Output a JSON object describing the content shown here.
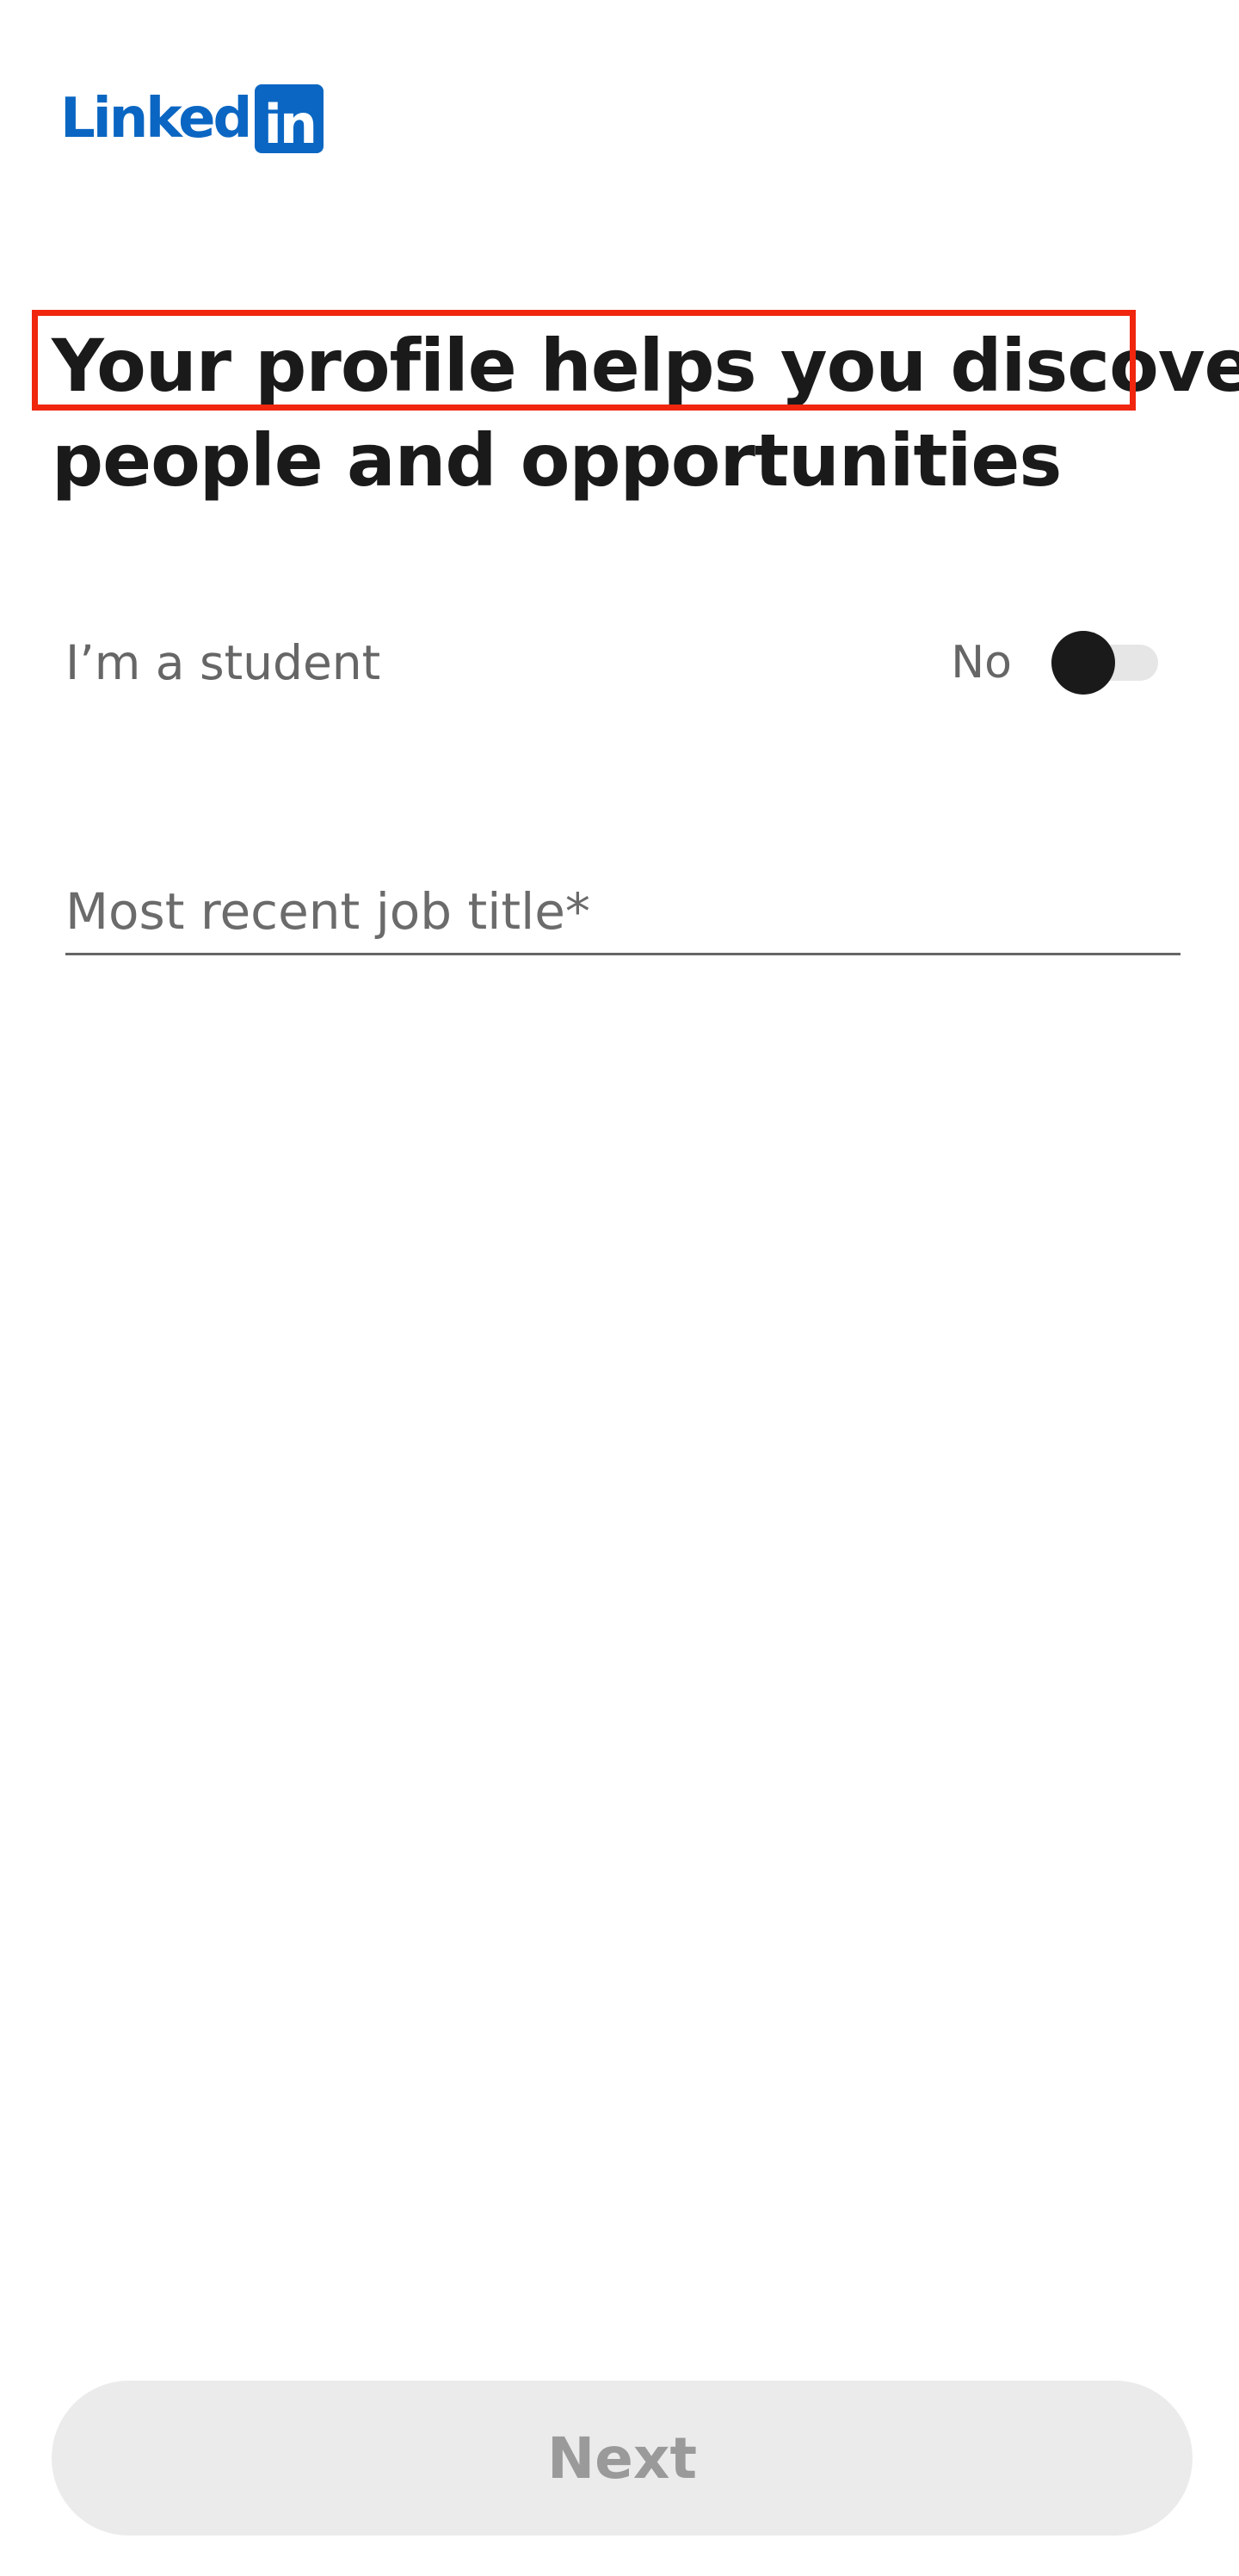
{
  "brand": {
    "word": "Linked",
    "box": "in",
    "color": "#0a66c2"
  },
  "headline": {
    "line1": "Your profile helps you discover",
    "line2": "people and opportunities"
  },
  "student": {
    "label": "I’m a student",
    "toggle_state": "No",
    "checked": false
  },
  "job_title": {
    "placeholder": "Most recent job title*",
    "value": ""
  },
  "next_button": {
    "label": "Next",
    "enabled": false
  },
  "colors": {
    "highlight_box": "#f0260e",
    "text_dark": "#1a1a1a",
    "text_muted": "#666666",
    "button_bg_disabled": "#ebebeb",
    "button_text_disabled": "#9a9a9a"
  }
}
